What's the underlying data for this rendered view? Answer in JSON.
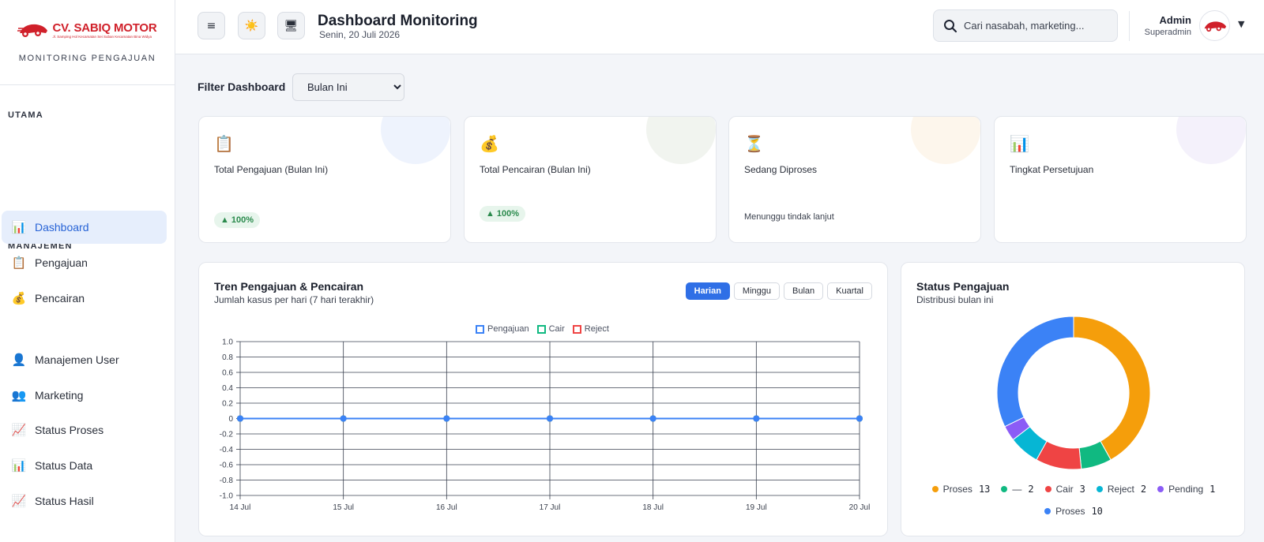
{
  "brand": {
    "name": "CV. SABIQ MOTOR",
    "address": "Jl. Samping Hol Kecamatan Sei Suban Kecamatan Bina Widya",
    "caption": "MONITORING PENGAJUAN"
  },
  "sidebar": {
    "sections": [
      {
        "label": "UTAMA"
      },
      {
        "label": "MANAJEMEN"
      }
    ],
    "items": [
      {
        "label": "Dashboard",
        "icon": "bar-chart-icon",
        "active": true
      },
      {
        "label": "Pengajuan",
        "icon": "clipboard-icon"
      },
      {
        "label": "Pencairan",
        "icon": "money-bag-icon"
      },
      {
        "label": "Manajemen User",
        "icon": "user-icon"
      },
      {
        "label": "Marketing",
        "icon": "users-icon"
      },
      {
        "label": "Status Proses",
        "icon": "trend-icon"
      },
      {
        "label": "Status Data",
        "icon": "bar-chart-icon"
      },
      {
        "label": "Status Hasil",
        "icon": "trend-icon"
      }
    ]
  },
  "header": {
    "menu_icon": "≡",
    "theme_icon": "☀️",
    "display_icon": "🖥",
    "title": "Dashboard Monitoring",
    "date": "Senin, 20 Juli 2026",
    "search_placeholder": "Cari nasabah, marketing...",
    "user_name": "Admin",
    "user_role": "Superadmin"
  },
  "filter": {
    "label": "Filter Dashboard",
    "selected": "Bulan Ini",
    "options": [
      "Bulan Ini"
    ]
  },
  "stats": [
    {
      "icon": "📋",
      "label": "Total Pengajuan (Bulan Ini)",
      "badge": "100%",
      "note": "",
      "bubble_color": "#eef3fd"
    },
    {
      "icon": "💰",
      "label": "Total Pencairan (Bulan Ini)",
      "badge": "100%",
      "note": "",
      "bubble_color": "#f1f4ef"
    },
    {
      "icon": "⏳",
      "label": "Sedang Diproses",
      "badge": "",
      "note": "Menunggu tindak lanjut",
      "bubble_color": "#fdf6ec"
    },
    {
      "icon": "📊",
      "label": "Tingkat Persetujuan",
      "badge": "",
      "note": "",
      "bubble_color": "#f4f1fb"
    }
  ],
  "trend": {
    "title": "Tren Pengajuan & Pencairan",
    "subtitle": "Jumlah kasus per hari (7 hari terakhir)",
    "tabs": [
      "Harian",
      "Minggu",
      "Bulan",
      "Kuartal"
    ],
    "active_tab": "Harian"
  },
  "status": {
    "title": "Status Pengajuan",
    "subtitle": "Distribusi bulan ini"
  },
  "chart_data": [
    {
      "type": "line",
      "categories": [
        "14 Jul",
        "15 Jul",
        "16 Jul",
        "17 Jul",
        "18 Jul",
        "19 Jul",
        "20 Jul"
      ],
      "ylim": [
        -1.0,
        1.0
      ],
      "yticks": [
        "1.0",
        "0.8",
        "0.6",
        "0.4",
        "0.2",
        "0",
        "-0.2",
        "-0.4",
        "-0.6",
        "-0.8",
        "-1.0"
      ],
      "grid": true,
      "legend": "top-center",
      "series": [
        {
          "name": "Pengajuan",
          "color": "#3b82f6",
          "values": [
            0,
            0,
            0,
            0,
            0,
            0,
            0
          ]
        },
        {
          "name": "Cair",
          "color": "#10b981",
          "values": [
            0,
            0,
            0,
            0,
            0,
            0,
            0
          ]
        },
        {
          "name": "Reject",
          "color": "#ef4444",
          "values": [
            0,
            0,
            0,
            0,
            0,
            0,
            0
          ]
        }
      ]
    },
    {
      "type": "pie",
      "legend": "bottom",
      "slices": [
        {
          "label": "Proses",
          "value": 13,
          "color": "#f59e0b"
        },
        {
          "label": "—",
          "value": 2,
          "color": "#10b981"
        },
        {
          "label": "Cair",
          "value": 3,
          "color": "#ef4444"
        },
        {
          "label": "Reject",
          "value": 2,
          "color": "#06b6d4"
        },
        {
          "label": "Pending",
          "value": 1,
          "color": "#8b5cf6"
        },
        {
          "label": "Proses",
          "value": 10,
          "color": "#3b82f6"
        }
      ]
    }
  ]
}
